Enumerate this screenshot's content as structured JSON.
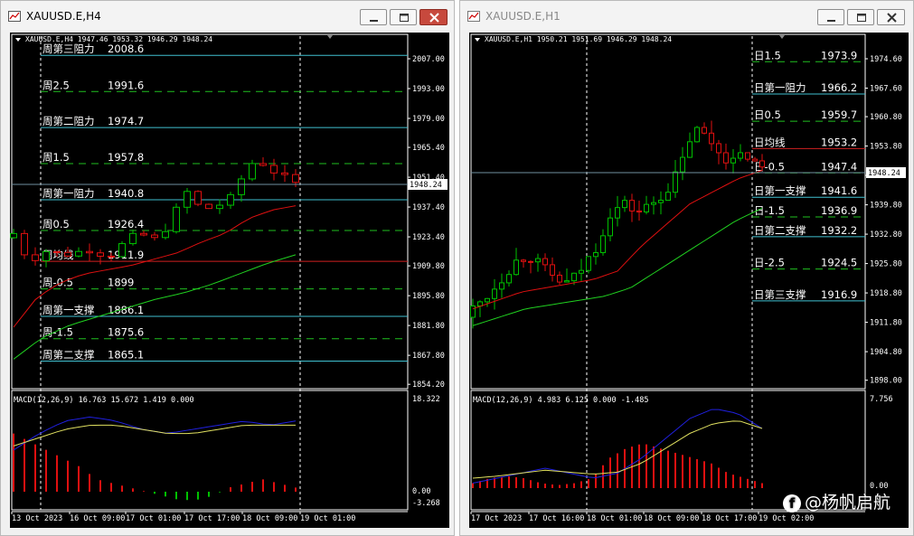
{
  "left": {
    "window_title": "XAUUSD.E,H4",
    "info_line": "XAUUSD.E,H4  1947.46 1953.32 1946.29 1948.24",
    "price_ticks": [
      "2007.00",
      "1993.00",
      "1979.00",
      "1965.40",
      "1951.40",
      "1937.40",
      "1923.40",
      "1909.80",
      "1895.80",
      "1881.80",
      "1867.80",
      "1854.20"
    ],
    "current_price": "1948.24",
    "levels": [
      {
        "name": "周第三阻力",
        "value": "2008.6",
        "style": "solid",
        "color": "#40c0d0"
      },
      {
        "name": "周2.5",
        "value": "1991.6",
        "style": "dashed",
        "color": "#20c020"
      },
      {
        "name": "周第二阻力",
        "value": "1974.7",
        "style": "solid",
        "color": "#40c0d0"
      },
      {
        "name": "周1.5",
        "value": "1957.8",
        "style": "dashed",
        "color": "#20c020"
      },
      {
        "name": "周第一阻力",
        "value": "1940.8",
        "style": "solid",
        "color": "#40c0d0"
      },
      {
        "name": "周0.5",
        "value": "1926.4",
        "style": "dashed",
        "color": "#20c020"
      },
      {
        "name": "周均线",
        "value": "1911.9",
        "style": "solid",
        "color": "#d02020"
      },
      {
        "name": "周-0.5",
        "value": "1899",
        "style": "dashed",
        "color": "#20c020"
      },
      {
        "name": "周第一支撑",
        "value": "1886.1",
        "style": "solid",
        "color": "#40c0d0"
      },
      {
        "name": "周-1.5",
        "value": "1875.6",
        "style": "dashed",
        "color": "#20c020"
      },
      {
        "name": "周第二支撑",
        "value": "1865.1",
        "style": "solid",
        "color": "#40c0d0"
      }
    ],
    "macd_label": "MACD(12,26,9) 16.763 15.672 1.419 0.000",
    "macd_ticks": [
      "18.322",
      "0.00",
      "-3.268"
    ],
    "time_labels": [
      "13 Oct 2023",
      "16 Oct 09:00",
      "17 Oct 01:00",
      "17 Oct 17:00",
      "18 Oct 09:00",
      "19 Oct 01:00"
    ]
  },
  "right": {
    "window_title": "XAUUSD.E,H1",
    "info_line": "XAUUSD.E,H1  1950.21 1951.69 1946.29 1948.24",
    "price_ticks": [
      "1974.60",
      "1967.60",
      "1960.80",
      "1953.80",
      "1946.80",
      "1939.80",
      "1932.80",
      "1925.80",
      "1918.80",
      "1911.80",
      "1904.80",
      "1898.00"
    ],
    "current_price": "1948.24",
    "levels": [
      {
        "name": "日1.5",
        "value": "1973.9",
        "style": "dashed",
        "color": "#20c020"
      },
      {
        "name": "日第一阻力",
        "value": "1966.2",
        "style": "solid",
        "color": "#40c0d0"
      },
      {
        "name": "日0.5",
        "value": "1959.7",
        "style": "dashed",
        "color": "#20c020"
      },
      {
        "name": "日均线",
        "value": "1953.2",
        "style": "solid",
        "color": "#d02020"
      },
      {
        "name": "日-0.5",
        "value": "1947.4",
        "style": "dashed",
        "color": "#20c020"
      },
      {
        "name": "日第一支撑",
        "value": "1941.6",
        "style": "solid",
        "color": "#40c0d0"
      },
      {
        "name": "日-1.5",
        "value": "1936.9",
        "style": "dashed",
        "color": "#20c020"
      },
      {
        "name": "日第二支撑",
        "value": "1932.2",
        "style": "solid",
        "color": "#40c0d0"
      },
      {
        "name": "日-2.5",
        "value": "1924.5",
        "style": "dashed",
        "color": "#20c020"
      },
      {
        "name": "日第三支撑",
        "value": "1916.9",
        "style": "solid",
        "color": "#40c0d0"
      }
    ],
    "macd_label": "MACD(12,26,9) 4.983 6.125 0.000 -1.485",
    "macd_ticks": [
      "7.756",
      "0.00"
    ],
    "time_labels": [
      "17 Oct 2023",
      "17 Oct 16:00",
      "18 Oct 01:00",
      "18 Oct 09:00",
      "18 Oct 17:00",
      "19 Oct 02:00"
    ]
  },
  "watermark": {
    "icon": "f",
    "text": "@杨帆启航"
  },
  "colors": {
    "bull": "#00c000",
    "bear": "#e01010",
    "ma_fast": "#e01010",
    "ma_slow": "#20d020",
    "macd_main": "#2020e0",
    "macd_signal": "#e0e060",
    "hist": "#e01010"
  }
}
